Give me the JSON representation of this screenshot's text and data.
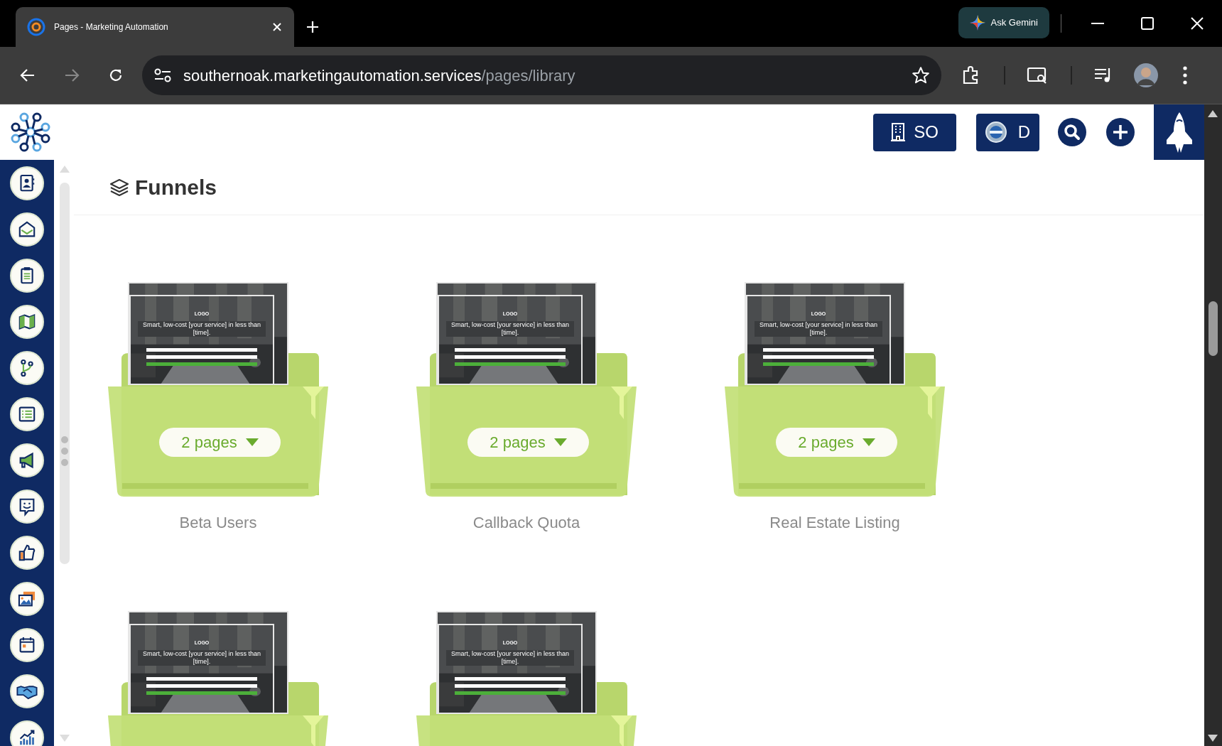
{
  "browser": {
    "tab_title": "Pages - Marketing Automation",
    "url_host": "southernoak.marketingautomation.services",
    "url_path": "/pages/library",
    "ask_gemini": "Ask Gemini"
  },
  "header": {
    "account_button": "SO",
    "user_button": "D"
  },
  "page_title": "Funnels",
  "funnels": [
    {
      "preview_logo": "LOGO",
      "preview_headline": "Smart, low-cost [your service] in less than [time].",
      "pages_label": "2 pages",
      "name": "Beta Users"
    },
    {
      "preview_logo": "LOGO",
      "preview_headline": "Smart, low-cost [your service] in less than [time].",
      "pages_label": "2 pages",
      "name": "Callback Quota"
    },
    {
      "preview_logo": "LOGO",
      "preview_headline": "Smart, low-cost [your service] in less than [time].",
      "pages_label": "2 pages",
      "name": "Real Estate Listing"
    },
    {
      "preview_logo": "LOGO",
      "preview_headline": "Smart, low-cost [your service] in less than [time]."
    },
    {
      "preview_logo": "LOGO",
      "preview_headline": "Smart, low-cost [your service] in less than [time]."
    }
  ]
}
